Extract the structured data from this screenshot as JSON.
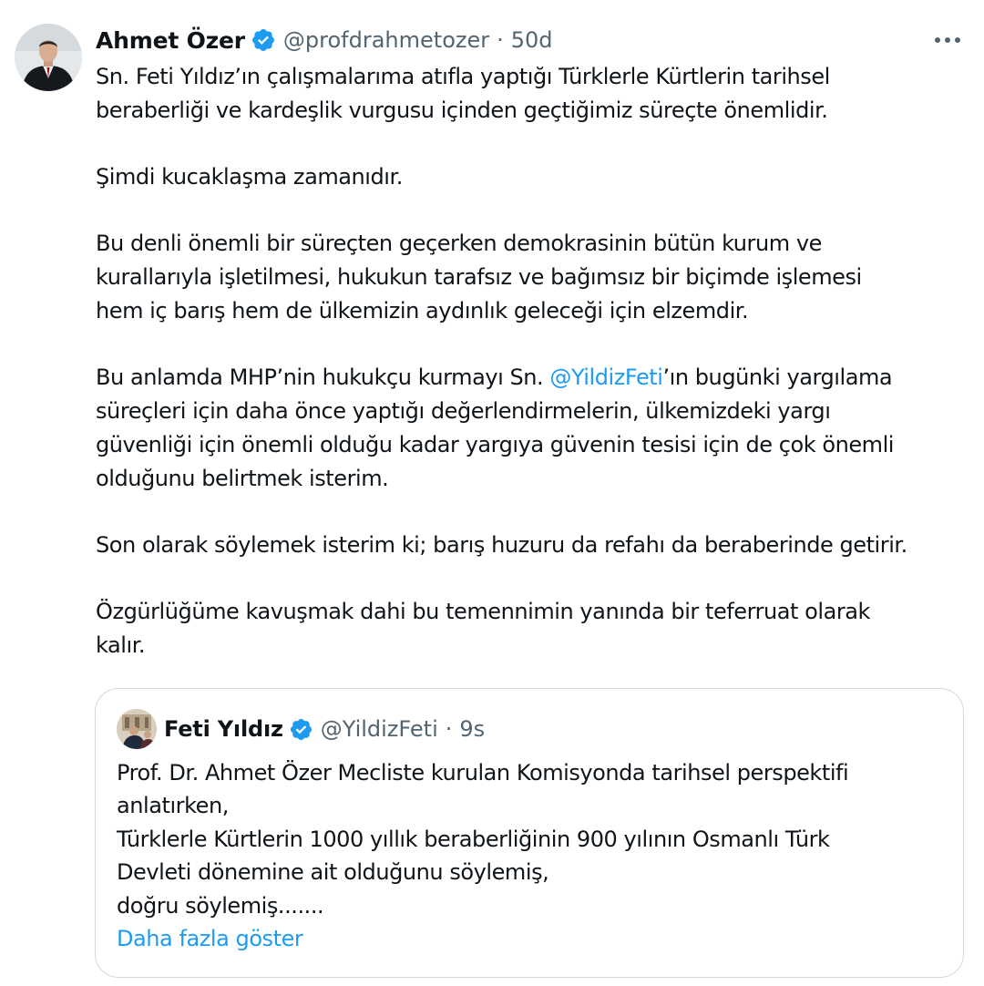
{
  "tweet": {
    "author_name": "Ahmet Özer",
    "handle": "@profdrahmetozer",
    "separator": "·",
    "time": "50d",
    "paragraphs": [
      {
        "lines": [
          "Sn. Feti Yıldız’ın çalışmalarıma atıfla yaptığı Türklerle Kürtlerin tarihsel",
          "beraberliği ve kardeşlik vurgusu içinden geçtiğimiz süreçte önemlidir."
        ]
      },
      {
        "lines": [
          "Şimdi kucaklaşma zamanıdır."
        ]
      },
      {
        "lines": [
          "Bu denli önemli bir süreçten geçerken demokrasinin bütün kurum ve",
          "kurallarıyla işletilmesi, hukukun tarafsız ve bağımsız bir biçimde işlemesi",
          "hem iç barış hem de ülkemizin aydınlık geleceği için elzemdir."
        ]
      },
      {
        "line1_before": "Bu anlamda MHP’nin hukukçu kurmayı Sn. ",
        "mention": "@YildizFeti",
        "line1_after": "’ın bugünki yargılama",
        "lines_rest": [
          "süreçleri için daha önce yaptığı değerlendirmelerin, ülkemizdeki yargı",
          "güvenliği için önemli olduğu kadar yargıya güvenin tesisi için de çok önemli",
          "olduğunu belirtmek isterim."
        ]
      },
      {
        "lines": [
          "Son olarak söylemek isterim ki; barış huzuru da refahı da beraberinde getirir."
        ]
      },
      {
        "lines": [
          "Özgürlüğüme kavuşmak dahi bu temennimin yanında bir teferruat olarak",
          "kalır."
        ]
      }
    ]
  },
  "quoted": {
    "author_name": "Feti Yıldız",
    "handle": "@YildizFeti",
    "separator": "·",
    "time": "9s",
    "lines": [
      "Prof. Dr. Ahmet Özer Mecliste kurulan Komisyonda tarihsel perspektifi",
      "anlatırken,",
      "Türklerle Kürtlerin 1000 yıllık beraberliğinin 900  yılının Osmanlı Türk",
      "Devleti dönemine ait olduğunu söylemiş,",
      "doğru söylemiş......."
    ],
    "show_more": "Daha fazla göster"
  },
  "icons": {
    "verified": "verified-badge-icon",
    "more": "more-horizontal-icon"
  },
  "colors": {
    "link": "#1d9bf0",
    "verified": "#1d9bf0",
    "secondary_text": "#536471",
    "border": "#cfd9de"
  }
}
